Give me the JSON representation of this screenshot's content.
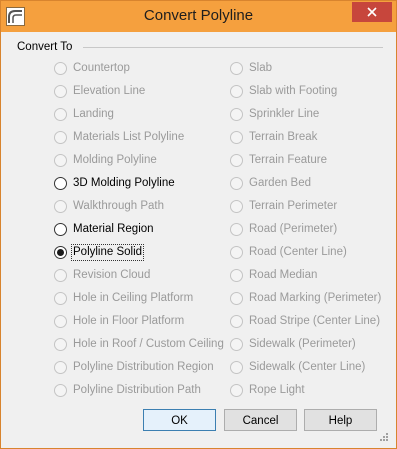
{
  "window": {
    "title": "Convert Polyline"
  },
  "group": {
    "label": "Convert To"
  },
  "options_left": [
    {
      "label": "Countertop",
      "enabled": false,
      "checked": false
    },
    {
      "label": "Elevation Line",
      "enabled": false,
      "checked": false
    },
    {
      "label": "Landing",
      "enabled": false,
      "checked": false
    },
    {
      "label": "Materials List Polyline",
      "enabled": false,
      "checked": false
    },
    {
      "label": "Molding Polyline",
      "enabled": false,
      "checked": false
    },
    {
      "label": "3D Molding Polyline",
      "enabled": true,
      "checked": false
    },
    {
      "label": "Walkthrough Path",
      "enabled": false,
      "checked": false
    },
    {
      "label": "Material Region",
      "enabled": true,
      "checked": false
    },
    {
      "label": "Polyline Solid",
      "enabled": true,
      "checked": true
    },
    {
      "label": "Revision Cloud",
      "enabled": false,
      "checked": false
    },
    {
      "label": "Hole in Ceiling Platform",
      "enabled": false,
      "checked": false
    },
    {
      "label": "Hole in Floor Platform",
      "enabled": false,
      "checked": false
    },
    {
      "label": "Hole in Roof / Custom Ceiling",
      "enabled": false,
      "checked": false
    },
    {
      "label": "Polyline Distribution Region",
      "enabled": false,
      "checked": false
    },
    {
      "label": "Polyline Distribution Path",
      "enabled": false,
      "checked": false
    }
  ],
  "options_right": [
    {
      "label": "Slab",
      "enabled": false,
      "checked": false
    },
    {
      "label": "Slab with Footing",
      "enabled": false,
      "checked": false
    },
    {
      "label": "Sprinkler Line",
      "enabled": false,
      "checked": false
    },
    {
      "label": "Terrain Break",
      "enabled": false,
      "checked": false
    },
    {
      "label": "Terrain Feature",
      "enabled": false,
      "checked": false
    },
    {
      "label": "Garden Bed",
      "enabled": false,
      "checked": false
    },
    {
      "label": "Terrain Perimeter",
      "enabled": false,
      "checked": false
    },
    {
      "label": "Road (Perimeter)",
      "enabled": false,
      "checked": false
    },
    {
      "label": "Road (Center Line)",
      "enabled": false,
      "checked": false
    },
    {
      "label": "Road Median",
      "enabled": false,
      "checked": false
    },
    {
      "label": "Road Marking (Perimeter)",
      "enabled": false,
      "checked": false
    },
    {
      "label": "Road Stripe (Center Line)",
      "enabled": false,
      "checked": false
    },
    {
      "label": "Sidewalk (Perimeter)",
      "enabled": false,
      "checked": false
    },
    {
      "label": "Sidewalk (Center Line)",
      "enabled": false,
      "checked": false
    },
    {
      "label": "Rope Light",
      "enabled": false,
      "checked": false
    }
  ],
  "buttons": {
    "ok": "OK",
    "cancel": "Cancel",
    "help": "Help"
  },
  "colors": {
    "titlebar": "#f5a03e",
    "close": "#c7463c",
    "disabled_text": "#9a9a9a",
    "default_button": "#e5f1fb"
  },
  "icons": {
    "app": "arch-roof-icon",
    "close": "close-icon",
    "grip": "resize-grip-icon"
  }
}
